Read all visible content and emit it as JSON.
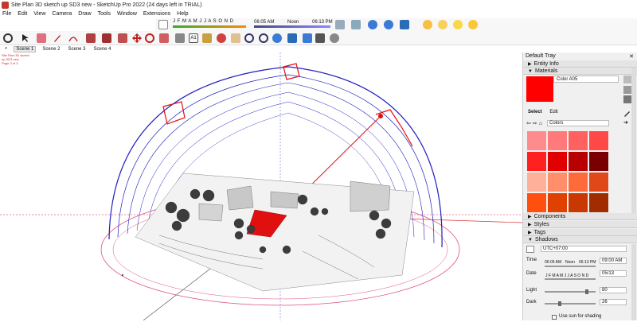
{
  "window": {
    "title": "Site Plan 3D sketch up SD3 new - SketchUp Pro 2022 (24 days left in TRIAL)"
  },
  "menu": [
    "File",
    "Edit",
    "View",
    "Camera",
    "Draw",
    "Tools",
    "Window",
    "Extensions",
    "Help"
  ],
  "sun_toolbar": {
    "months": "J F M A M J J A S O N D",
    "time_start": "06:05 AM",
    "time_noon": "Noon",
    "time_end": "06:13 PM"
  },
  "scenes": [
    "Scene 1",
    "Scene 2",
    "Scene 3",
    "Scene 4"
  ],
  "active_scene": "Scene 1",
  "tray": {
    "title": "Default Tray",
    "sections": {
      "entity_info": "Entity Info",
      "materials": "Materials",
      "components": "Components",
      "styles": "Styles",
      "tags": "Tags",
      "shadows": "Shadows"
    },
    "materials": {
      "current_name": "Color A05",
      "current_color": "#ff0000",
      "tab_select": "Select",
      "tab_edit": "Edit",
      "library": "Colors",
      "palette": [
        "#ff8c8c",
        "#ff7b7b",
        "#ff6060",
        "#ff4848",
        "#ff2020",
        "#e00000",
        "#b80000",
        "#7a0000",
        "#ffb09a",
        "#ff8f6a",
        "#ff6a3a",
        "#e0481a",
        "#ff5010",
        "#e04000",
        "#c83800",
        "#a02c00"
      ]
    },
    "shadows": {
      "timezone": "UTC+07:00",
      "time_label": "Time",
      "time_start": "06:05 AM",
      "time_noon": "Noon",
      "time_end": "06:13 PM",
      "time_value": "09:00 AM",
      "date_label": "Date",
      "date_months": "J F M A M J J A S O N D",
      "date_value": "05/13",
      "light_label": "Light",
      "light_value": "80",
      "dark_label": "Dark",
      "dark_value": "26",
      "use_sun_label": "Use sun for shading"
    }
  },
  "viewport": {
    "corner_text": [
      "Site Plan 3D sketch",
      "up SD3 new",
      "Page 3 of 3"
    ]
  }
}
